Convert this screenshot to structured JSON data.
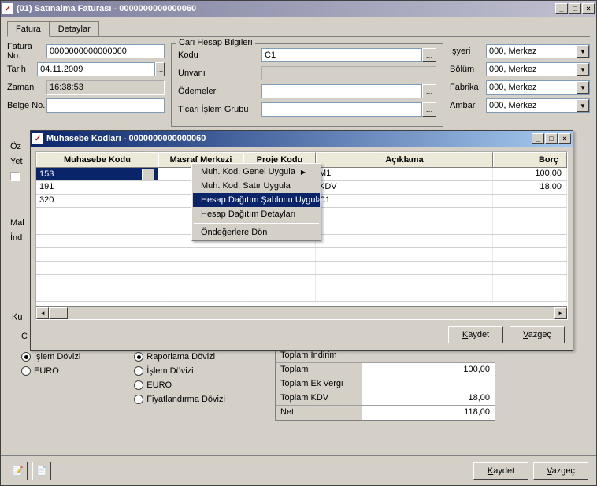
{
  "main_window": {
    "title": "(01) Satınalma Faturası - 0000000000000060",
    "icon_char": "✓"
  },
  "tabs": {
    "invoice": "Fatura",
    "details": "Detaylar"
  },
  "form": {
    "invoice_no_label": "Fatura No.",
    "invoice_no": "0000000000000060",
    "date_label": "Tarih",
    "date": "04.11.2009",
    "time_label": "Zaman",
    "time": "16:38:53",
    "docno_label": "Belge No."
  },
  "cari": {
    "group_title": "Cari Hesap Bilgileri",
    "kodu_label": "Kodu",
    "kodu": "C1",
    "unvani_label": "Unvanı",
    "odemeler_label": "Ödemeler",
    "ticari_label": "Ticari İşlem Grubu"
  },
  "right": {
    "isyeri_label": "İşyeri",
    "isyeri": "000, Merkez",
    "bolum_label": "Bölüm",
    "bolum": "000, Merkez",
    "fabrika_label": "Fabrika",
    "fabrika": "000, Merkez",
    "ambar_label": "Ambar",
    "ambar": "000, Merkez"
  },
  "bg": {
    "oz": "Öz",
    "yet": "Yet",
    "mal": "Mal",
    "ind": "İnd",
    "ku": "Ku",
    "c": "C"
  },
  "dialog": {
    "title": "Muhasebe Kodları - 0000000000000060",
    "columns": {
      "code": "Muhasebe  Kodu",
      "cost": "Masraf Merkezi",
      "project": "Proje Kodu",
      "desc": "Açıklama",
      "debit": "Borç"
    },
    "rows": [
      {
        "code": "153",
        "desc": "M1",
        "debit": "100,00"
      },
      {
        "code": "191",
        "desc": "KDV",
        "debit": "18,00"
      },
      {
        "code": "320",
        "desc": "C1",
        "debit": ""
      }
    ],
    "save": "Kaydet",
    "save_u": "K",
    "cancel": "Vazgeç",
    "cancel_u": "V"
  },
  "ctx": {
    "item1": "Muh. Kod. Genel Uygula",
    "item2": "Muh. Kod. Satır Uygula",
    "item3": "Hesap Dağıtım Şablonu Uygula",
    "item4": "Hesap Dağıtım Detayları",
    "item5": "Öndeğerlere Dön"
  },
  "radios": {
    "islem_dovizi": "İşlem Dövizi",
    "euro": "EURO",
    "raporlama": "Raporlama Dövizi",
    "fiyat": "Fiyatlandırma Dövizi"
  },
  "totals": {
    "indirim_label": "Toplam İndirim",
    "indirim": "",
    "toplam_label": "Toplam",
    "toplam": "100,00",
    "ekvergi_label": "Toplam Ek Vergi",
    "ekvergi": "",
    "kdv_label": "Toplam KDV",
    "kdv": "18,00",
    "net_label": "Net",
    "net": "118,00"
  },
  "footer": {
    "save": "Kaydet",
    "save_u": "K",
    "cancel": "Vazgeç",
    "cancel_u": "V"
  }
}
